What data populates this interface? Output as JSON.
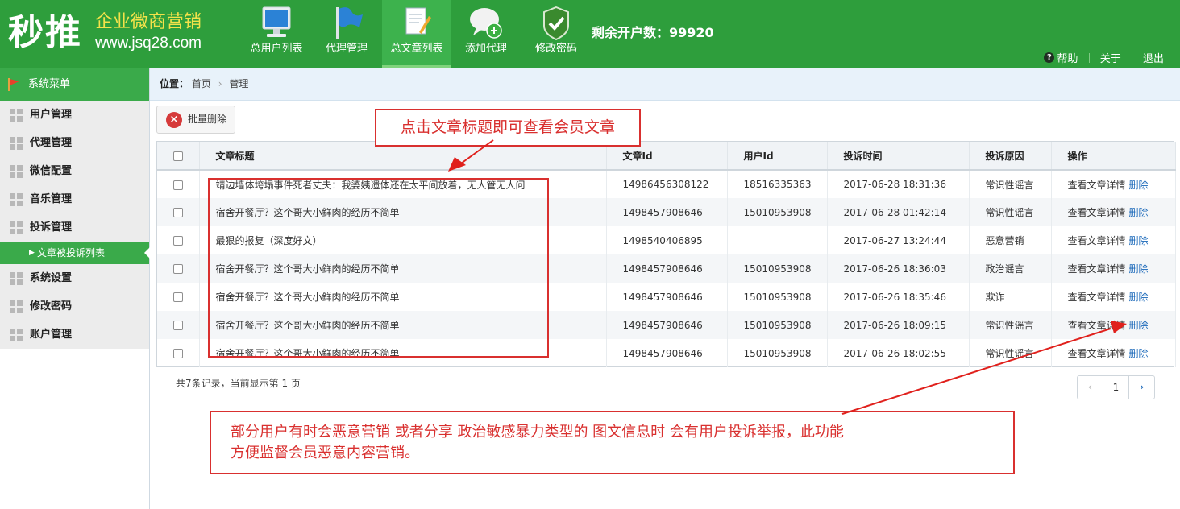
{
  "header": {
    "logo_main": "秒推",
    "logo_sub": "企业微商营销",
    "logo_url": "www.jsq28.com",
    "nav": [
      {
        "label": "总用户列表",
        "icon": "monitor-icon"
      },
      {
        "label": "代理管理",
        "icon": "flag-icon"
      },
      {
        "label": "总文章列表",
        "icon": "document-icon",
        "active": true
      },
      {
        "label": "添加代理",
        "icon": "chat-add-icon"
      },
      {
        "label": "修改密码",
        "icon": "shield-check-icon"
      }
    ],
    "remaining": "剩余开户数：99920",
    "links": {
      "help": "帮助",
      "about": "关于",
      "logout": "退出"
    }
  },
  "sidebar": {
    "title": "系统菜单",
    "items": [
      {
        "label": "用户管理"
      },
      {
        "label": "代理管理"
      },
      {
        "label": "微信配置"
      },
      {
        "label": "音乐管理"
      },
      {
        "label": "投诉管理"
      },
      {
        "label": "系统设置"
      },
      {
        "label": "修改密码"
      },
      {
        "label": "账户管理"
      }
    ],
    "sub_active": "文章被投诉列表"
  },
  "breadcrumb": {
    "prefix": "位置：",
    "home": "首页",
    "current": "管理"
  },
  "toolbar": {
    "batch_delete": "批量删除"
  },
  "table": {
    "columns": [
      "文章标题",
      "文章Id",
      "用户Id",
      "投诉时间",
      "投诉原因",
      "操作"
    ],
    "view_label": "查看文章详情",
    "delete_label": "删除",
    "rows": [
      {
        "title": "靖边墙体垮塌事件死者丈夫：我婆姨遗体还在太平间放着，无人管无人问",
        "article_id": "14986456308122",
        "user_id": "18516335363",
        "time": "2017-06-28 18:31:36",
        "reason": "常识性谣言"
      },
      {
        "title": "宿舍开餐厅？这个哥大小鲜肉的经历不简单",
        "article_id": "1498457908646",
        "user_id": "15010953908",
        "time": "2017-06-28 01:42:14",
        "reason": "常识性谣言"
      },
      {
        "title": "最狠的报复（深度好文）",
        "article_id": "1498540406895",
        "user_id": "",
        "time": "2017-06-27 13:24:44",
        "reason": "恶意营销"
      },
      {
        "title": "宿舍开餐厅？这个哥大小鲜肉的经历不简单",
        "article_id": "1498457908646",
        "user_id": "15010953908",
        "time": "2017-06-26 18:36:03",
        "reason": "政治谣言"
      },
      {
        "title": "宿舍开餐厅？这个哥大小鲜肉的经历不简单",
        "article_id": "1498457908646",
        "user_id": "15010953908",
        "time": "2017-06-26 18:35:46",
        "reason": "欺诈"
      },
      {
        "title": "宿舍开餐厅？这个哥大小鲜肉的经历不简单",
        "article_id": "1498457908646",
        "user_id": "15010953908",
        "time": "2017-06-26 18:09:15",
        "reason": "常识性谣言"
      },
      {
        "title": "宿舍开餐厅？这个哥大小鲜肉的经历不简单",
        "article_id": "1498457908646",
        "user_id": "15010953908",
        "time": "2017-06-26 18:02:55",
        "reason": "常识性谣言"
      }
    ]
  },
  "footer": {
    "records": "共7条记录，当前显示第 1 页",
    "page": "1",
    "prev": "‹",
    "next": "›"
  },
  "annotations": {
    "top": "点击文章标题即可查看会员文章",
    "bottom_line1": "部分用户有时会恶意营销 或者分享 政治敏感暴力类型的 图文信息时 会有用户投诉举报，此功能",
    "bottom_line2": "方便监督会员恶意内容营销。"
  },
  "colors": {
    "header_green": "#2e9e3c",
    "active_green": "#3aaa4a",
    "annotation_red": "#d9302f",
    "link_blue": "#1565b8"
  }
}
